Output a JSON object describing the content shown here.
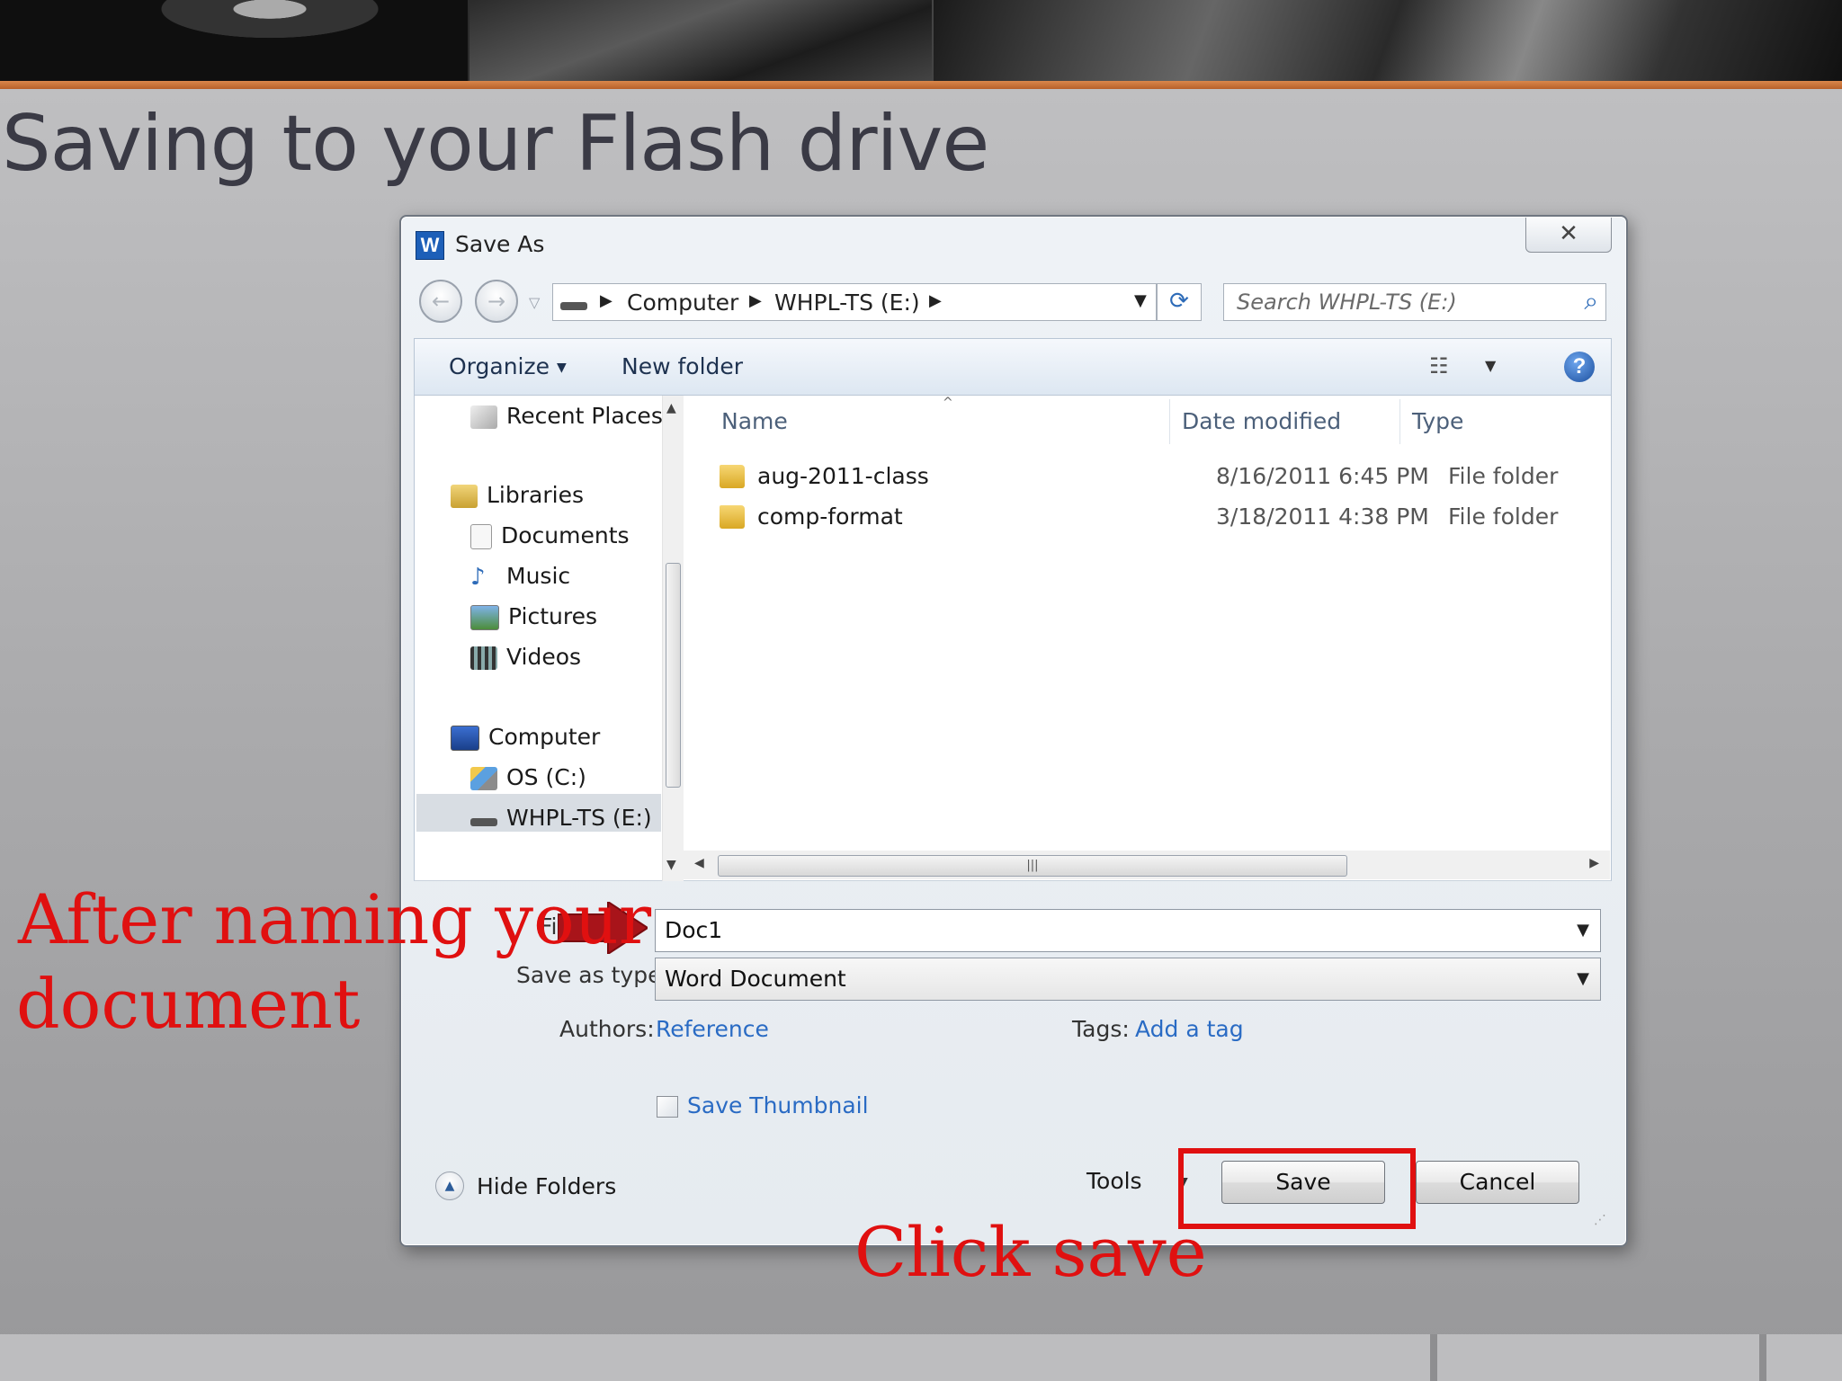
{
  "slide": {
    "title": "Saving to your Flash drive"
  },
  "dialog": {
    "title": "Save As",
    "app_icon_letter": "W",
    "close_glyph": "✕",
    "breadcrumb": [
      "Computer",
      "WHPL-TS (E:)"
    ],
    "search_placeholder": "Search WHPL-TS (E:)",
    "toolbar": {
      "organize_label": "Organize",
      "new_folder_label": "New folder"
    },
    "nav_pane": {
      "recent_places": "Recent Places",
      "libraries": "Libraries",
      "documents": "Documents",
      "music": "Music",
      "pictures": "Pictures",
      "videos": "Videos",
      "computer": "Computer",
      "os_drive": "OS (C:)",
      "flash_drive": "WHPL-TS (E:)"
    },
    "columns": {
      "name": "Name",
      "date": "Date modified",
      "type": "Type"
    },
    "files": [
      {
        "name": "aug-2011-class",
        "date": "8/16/2011 6:45 PM",
        "type": "File folder"
      },
      {
        "name": "comp-format",
        "date": "3/18/2011 4:38 PM",
        "type": "File folder"
      }
    ],
    "form": {
      "filename_label_partial": "Fi",
      "filename_label_colon": ":",
      "filename_value": "Doc1",
      "savetype_label": "Save as type:",
      "savetype_value": "Word Document",
      "authors_label": "Authors:",
      "authors_value": "Reference",
      "tags_label": "Tags:",
      "tags_value": "Add a tag",
      "thumbnail_label": "Save Thumbnail"
    },
    "footer": {
      "hide_folders_label": "Hide Folders",
      "tools_label": "Tools",
      "save_label": "Save",
      "cancel_label": "Cancel"
    }
  },
  "annotations": {
    "after_naming_line1": "After naming your",
    "after_naming_line2": "document",
    "click_save": "Click save"
  },
  "colors": {
    "annotation_red": "#e01010",
    "accent_orange": "#c7713a",
    "link_blue": "#2a6bc4"
  },
  "icons": {
    "back": "back-arrow-icon",
    "forward": "forward-arrow-icon",
    "refresh": "refresh-icon",
    "search": "search-icon",
    "help": "help-icon",
    "folder": "folder-icon"
  }
}
